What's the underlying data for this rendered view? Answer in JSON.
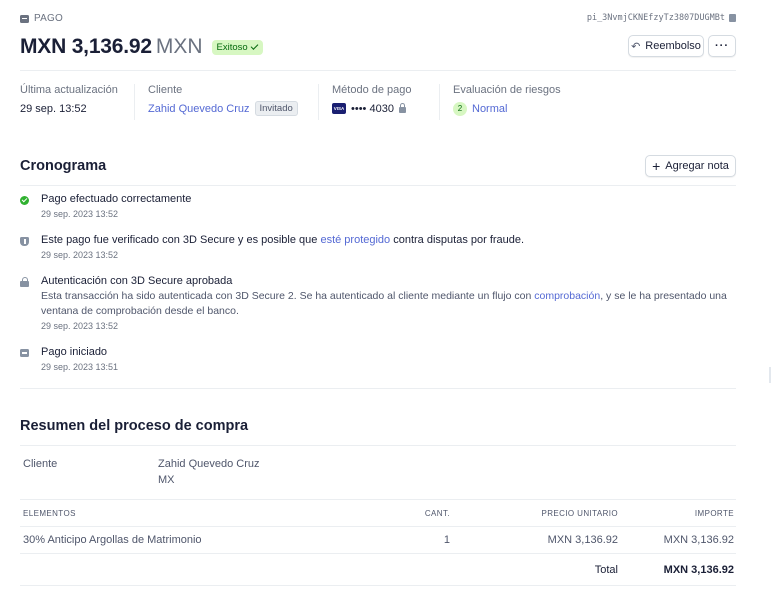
{
  "header": {
    "breadcrumb": "PAGO",
    "payment_id": "pi_3NvmjCKNEfzyTz3807DUGMBt",
    "amount": "MXN 3,136.92",
    "currency": "MXN",
    "status": "Exitoso",
    "refund_label": "Reembolso",
    "more_label": "···"
  },
  "summary": {
    "updated_label": "Última actualización",
    "updated_value": "29 sep. 13:52",
    "customer_label": "Cliente",
    "customer_name": "Zahid Quevedo Cruz",
    "customer_tag": "Invitado",
    "payment_method_label": "Método de pago",
    "card_brand": "VISA",
    "card_last4": "•••• 4030",
    "risk_label": "Evaluación de riesgos",
    "risk_score": "2",
    "risk_value": "Normal"
  },
  "timeline": {
    "title": "Cronograma",
    "add_note_label": "Agregar nota",
    "events": [
      {
        "title": "Pago efectuado correctamente",
        "time": "29 sep. 2023 13:52",
        "icon": "check-circle-icon"
      },
      {
        "title_before": "Este pago fue verificado con 3D Secure y es posible que ",
        "title_link": "esté protegido",
        "title_after": " contra disputas por fraude.",
        "time": "29 sep. 2023 13:52",
        "icon": "shield-icon"
      },
      {
        "title": "Autenticación con 3D Secure aprobada",
        "desc_before": "Esta transacción ha sido autenticada con 3D Secure 2. Se ha autenticado al cliente mediante un flujo con ",
        "desc_link": "comprobación",
        "desc_after": ", y se le ha presentado una ventana de comprobación desde el banco.",
        "time": "29 sep. 2023 13:52",
        "icon": "lock-icon"
      },
      {
        "title": "Pago iniciado",
        "time": "29 sep. 2023 13:51",
        "icon": "card-icon"
      }
    ]
  },
  "checkout": {
    "title": "Resumen del proceso de compra",
    "customer_label": "Cliente",
    "customer_name": "Zahid Quevedo Cruz",
    "customer_country": "MX",
    "columns": [
      "ELEMENTOS",
      "CANT.",
      "PRECIO UNITARIO",
      "IMPORTE"
    ],
    "items": [
      {
        "name": "30% Anticipo Argollas de Matrimonio",
        "qty": "1",
        "unit_price": "MXN 3,136.92",
        "amount": "MXN 3,136.92"
      }
    ],
    "total_label": "Total",
    "total_value": "MXN 3,136.92"
  }
}
